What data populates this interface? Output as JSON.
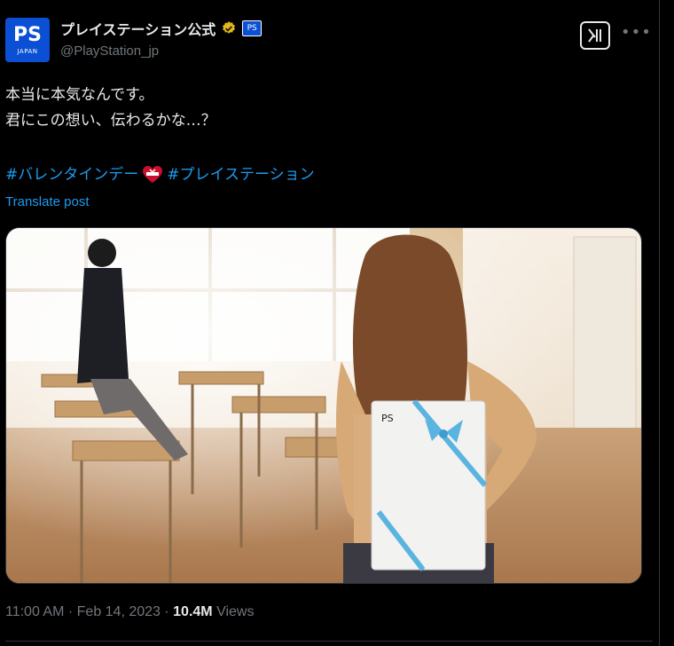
{
  "account": {
    "avatar_brand": "PS",
    "avatar_text": "JAPAN",
    "display_name": "プレイステーション公式",
    "handle": "@PlayStation_jp",
    "affiliate_badge": "PS"
  },
  "post": {
    "text_line1": "本当に本気なんです。",
    "text_line2": "君にこの想い、伝わるかな…？",
    "hashtag1": "#バレンタインデー",
    "hashtag2": "#プレイステーション",
    "translate_label": "Translate post"
  },
  "meta": {
    "time": "11:00 AM",
    "sep1": " · ",
    "date": "Feb 14, 2023",
    "sep2": " · ",
    "views_count": "10.4M",
    "views_label": " Views"
  },
  "icons": {
    "verified": "verified-badge-icon",
    "grok": "grok-icon",
    "more": "more-icon",
    "heart": "heart-gift-emoji"
  },
  "colors": {
    "background": "#000000",
    "text": "#e7e9ea",
    "muted": "#71767b",
    "link": "#1d9bf0",
    "verified_gold": "#e2b719",
    "ps_blue": "#0a4fd4"
  }
}
